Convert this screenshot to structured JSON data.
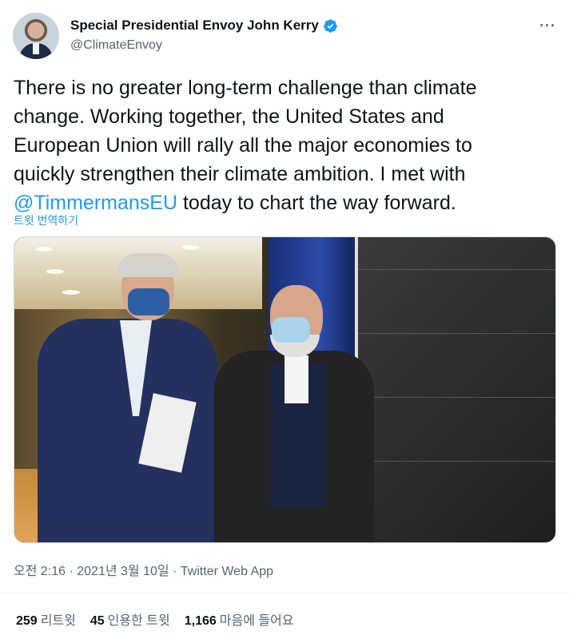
{
  "tweet": {
    "author_name": "Special Presidential Envoy John Kerry",
    "author_handle": "@ClimateEnvoy",
    "more_label": "···",
    "text_before": "There is no greater long-term challenge than climate\nchange. Working together, the United States and\nEuropean Union will rally all the major economies to\nquickly strengthen their climate ambition. I met with\n",
    "mention": "@TimmermansEU",
    "text_after": " today to chart the way forward.",
    "translate_label": "트윗 번역하기",
    "meta": "오전 2:16 · 2021년 3월 10일 · Twitter Web App",
    "stats": {
      "retweets_count": "259",
      "retweets_label": "리트윗",
      "quotes_count": "45",
      "quotes_label": "인용한 트윗",
      "likes_count": "1,166",
      "likes_label": "마음에 들어요"
    }
  },
  "colors": {
    "link": "#1d9bf0",
    "secondary_text": "#536471",
    "verified": "#1d9bf0"
  },
  "icons": {
    "verified": "verified-badge-icon",
    "more": "more-options-icon"
  }
}
